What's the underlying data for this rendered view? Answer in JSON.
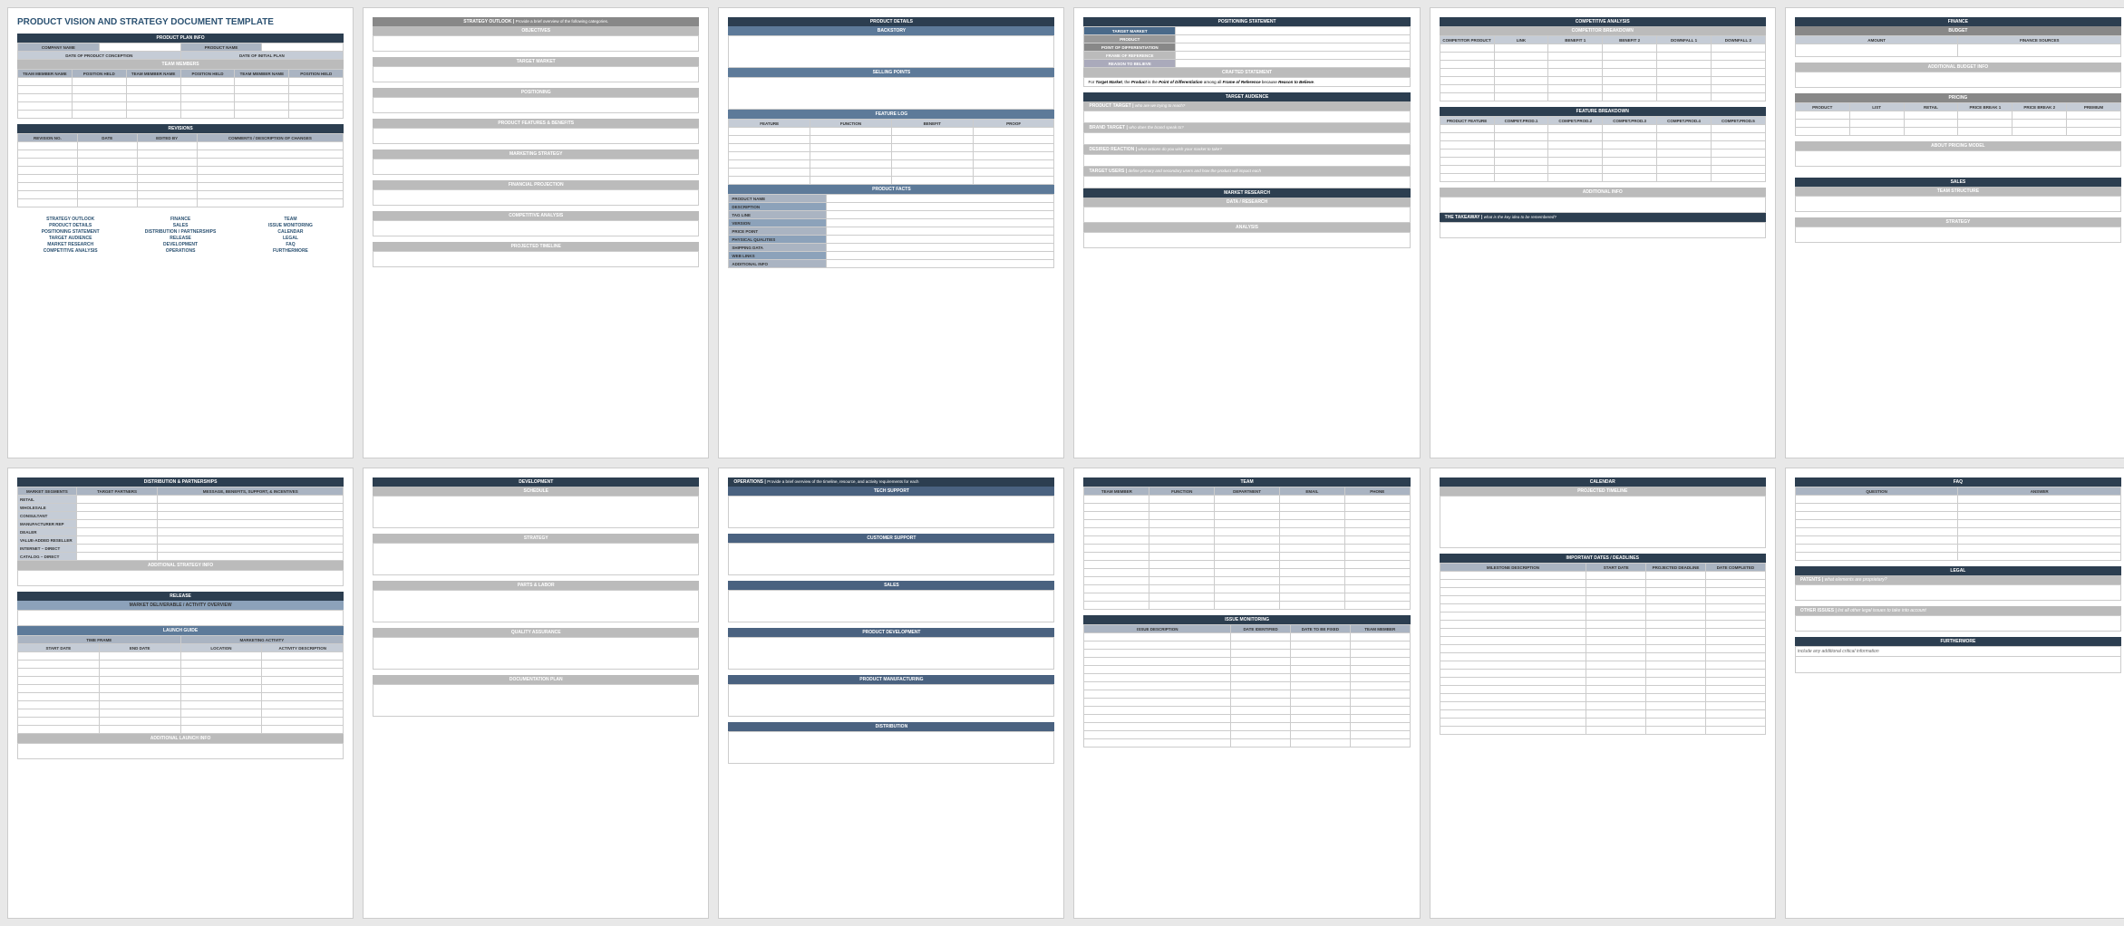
{
  "p1": {
    "title": "PRODUCT VISION AND STRATEGY DOCUMENT TEMPLATE",
    "plan_info": "PRODUCT PLAN INFO",
    "company_name": "COMPANY NAME",
    "product_name": "PRODUCT NAME",
    "date_conception": "DATE OF PRODUCT CONCEPTION",
    "date_initial": "DATE OF INITIAL PLAN",
    "team_members": "TEAM MEMBERS",
    "tm_name": "TEAM MEMBER NAME",
    "pos_held": "POSITION HELD",
    "revisions": "REVISIONS",
    "rev_no": "REVISION NO.",
    "date": "DATE",
    "edited_by": "EDITED BY",
    "comments": "COMMENTS / DESCRIPTION OF CHANGES",
    "links": [
      "STRATEGY OUTLOOK",
      "FINANCE",
      "TEAM",
      "PRODUCT DETAILS",
      "SALES",
      "ISSUE MONITORING",
      "POSITIONING STATEMENT",
      "DISTRIBUTION / PARTNERSHIPS",
      "CALENDAR",
      "TARGET AUDIENCE",
      "RELEASE",
      "LEGAL",
      "MARKET RESEARCH",
      "DEVELOPMENT",
      "FAQ",
      "COMPETITIVE ANALYSIS",
      "OPERATIONS",
      "FURTHERMORE"
    ]
  },
  "p2": {
    "title": "STRATEGY OUTLOOK",
    "sub": "Provide a brief overview of the following categories.",
    "s": [
      "OBJECTIVES",
      "TARGET MARKET",
      "POSITIONING",
      "PRODUCT FEATURES & BENEFITS",
      "MARKETING STRATEGY",
      "FINANCIAL PROJECTION",
      "COMPETITIVE ANALYSIS",
      "PROJECTED TIMELINE"
    ]
  },
  "p3": {
    "title": "PRODUCT DETAILS",
    "backstory": "BACKSTORY",
    "selling": "SELLING POINTS",
    "featlog": "FEATURE LOG",
    "fl_h": [
      "FEATURE",
      "FUNCTION",
      "BENEFIT",
      "PROOF"
    ],
    "facts": "PRODUCT FACTS",
    "rows": [
      "PRODUCT NAME",
      "DESCRIPTION",
      "TAG LINE",
      "VERSION",
      "PRICE POINT",
      "PHYSICAL QUALITIES",
      "SHIPPING DATA",
      "WEB LINKS",
      "ADDITIONAL INFO"
    ]
  },
  "p4": {
    "title": "POSITIONING STATEMENT",
    "rows": [
      "TARGET MARKET",
      "PRODUCT",
      "POINT OF DIFFERENTIATION",
      "FRAME OF REFERENCE",
      "REASON TO BELIEVE"
    ],
    "crafted": "CRAFTED STATEMENT",
    "crafted_text_a": "For ",
    "crafted_text_b": "Target Market",
    "crafted_text_c": ", the ",
    "crafted_text_d": "Product",
    "crafted_text_e": " is the ",
    "crafted_text_f": "Point of Differentiation",
    "crafted_text_g": " among all ",
    "crafted_text_h": "Frame of Reference",
    "crafted_text_i": " because ",
    "crafted_text_j": "Reason to Believe",
    "crafted_text_k": ".",
    "ta_title": "TARGET AUDIENCE",
    "ta": [
      {
        "l": "PRODUCT TARGET",
        "q": "who are we trying to reach?"
      },
      {
        "l": "BRAND TARGET",
        "q": "who does the brand speak to?"
      },
      {
        "l": "DESIRED REACTION",
        "q": "what actions do you wish your market to take?"
      },
      {
        "l": "TARGET USERS",
        "q": "define primary and secondary users and how the product will impact each"
      }
    ],
    "mr_title": "MARKET RESEARCH",
    "mr": [
      "DATA / RESEARCH",
      "ANALYSIS"
    ]
  },
  "p5": {
    "title": "COMPETITIVE ANALYSIS",
    "cb": "COMPETITOR BREAKDOWN",
    "cb_h": [
      "COMPETITOR PRODUCT",
      "LINK",
      "BENEFIT 1",
      "BENEFIT 2",
      "DOWNFALL 1",
      "DOWNFALL 2"
    ],
    "fb": "FEATURE BREAKDOWN",
    "fb_h": [
      "PRODUCT FEATURE",
      "COMPET.PROD.1",
      "COMPET.PROD.2",
      "COMPET.PROD.3",
      "COMPET.PROD.4",
      "COMPET.PROD.5"
    ],
    "add": "ADDITIONAL INFO",
    "take": "THE TAKEAWAY",
    "take_q": "what is the key idea to be remembered?"
  },
  "p6": {
    "title": "FINANCE",
    "budget": "BUDGET",
    "b_h": [
      "AMOUNT",
      "FINANCE SOURCES"
    ],
    "add_b": "ADDITIONAL BUDGET INFO",
    "pricing": "PRICING",
    "p_h": [
      "PRODUCT",
      "LIST",
      "RETAIL",
      "PRICE BREAK 1",
      "PRICE BREAK 2",
      "PREMIUM"
    ],
    "about_p": "ABOUT PRICING MODEL",
    "sales": "SALES",
    "ts": "TEAM STRUCTURE",
    "strat": "STRATEGY"
  },
  "p7": {
    "title": "DISTRIBUTION & PARTNERSHIPS",
    "h": [
      "MARKET SEGMENTS",
      "TARGET PARTNERS",
      "MESSAGE, BENEFITS, SUPPORT, & INCENTIVES"
    ],
    "segs": [
      "RETAIL",
      "WHOLESALE",
      "CONSULTANT",
      "MANUFACTURER REP",
      "DEALER",
      "VALUE-ADDED RESELLER",
      "INTERNET – DIRECT",
      "CATALOG – DIRECT"
    ],
    "as": "ADDITIONAL STRATEGY INFO",
    "release": "RELEASE",
    "mdao": "MARKET DELIVERABLE / ACTIVITY OVERVIEW",
    "lg": "LAUNCH GUIDE",
    "tf": "TIME FRAME",
    "ma": "MARKETING ACTIVITY",
    "sd": "START DATE",
    "ed": "END DATE",
    "loc": "LOCATION",
    "ad": "ACTIVITY DESCRIPTION",
    "ali": "ADDITIONAL LAUNCH INFO"
  },
  "p8": {
    "title": "DEVELOPMENT",
    "s": [
      "SCHEDULE",
      "STRATEGY",
      "PARTS & LABOR",
      "QUALITY ASSURANCE",
      "DOCUMENTATION PLAN"
    ]
  },
  "p9": {
    "title": "OPERATIONS",
    "sub": "Provide a brief overview of the timeline, resource, and activity requirements for each",
    "s": [
      "TECH SUPPORT",
      "CUSTOMER SUPPORT",
      "SALES",
      "PRODUCT DEVELOPMENT",
      "PRODUCT MANUFACTURING",
      "DISTRIBUTION"
    ]
  },
  "p10": {
    "title": "TEAM",
    "h": [
      "TEAM MEMBER",
      "FUNCTION",
      "DEPARTMENT",
      "EMAIL",
      "PHONE"
    ],
    "im": "ISSUE MONITORING",
    "im_h": [
      "ISSUE DESCRIPTION",
      "DATE IDENTIFIED",
      "DATE TO BE FIXED",
      "TEAM MEMBER"
    ]
  },
  "p11": {
    "title": "CALENDAR",
    "pt": "PROJECTED TIMELINE",
    "id": "IMPORTANT DATES / DEADLINES",
    "h": [
      "MILESTONE DESCRIPTION",
      "START DATE",
      "PROJECTED DEADLINE",
      "DATE COMPLETED"
    ]
  },
  "p12": {
    "faq": "FAQ",
    "fh": [
      "QUESTION",
      "ANSWER"
    ],
    "legal": "LEGAL",
    "pat": "PATENTS",
    "patq": "what elements are proprietary?",
    "oi": "OTHER ISSUES",
    "oiq": "list all other legal issues to take into account",
    "fur": "FURTHERMORE",
    "furnote": "include any additional critical information"
  }
}
